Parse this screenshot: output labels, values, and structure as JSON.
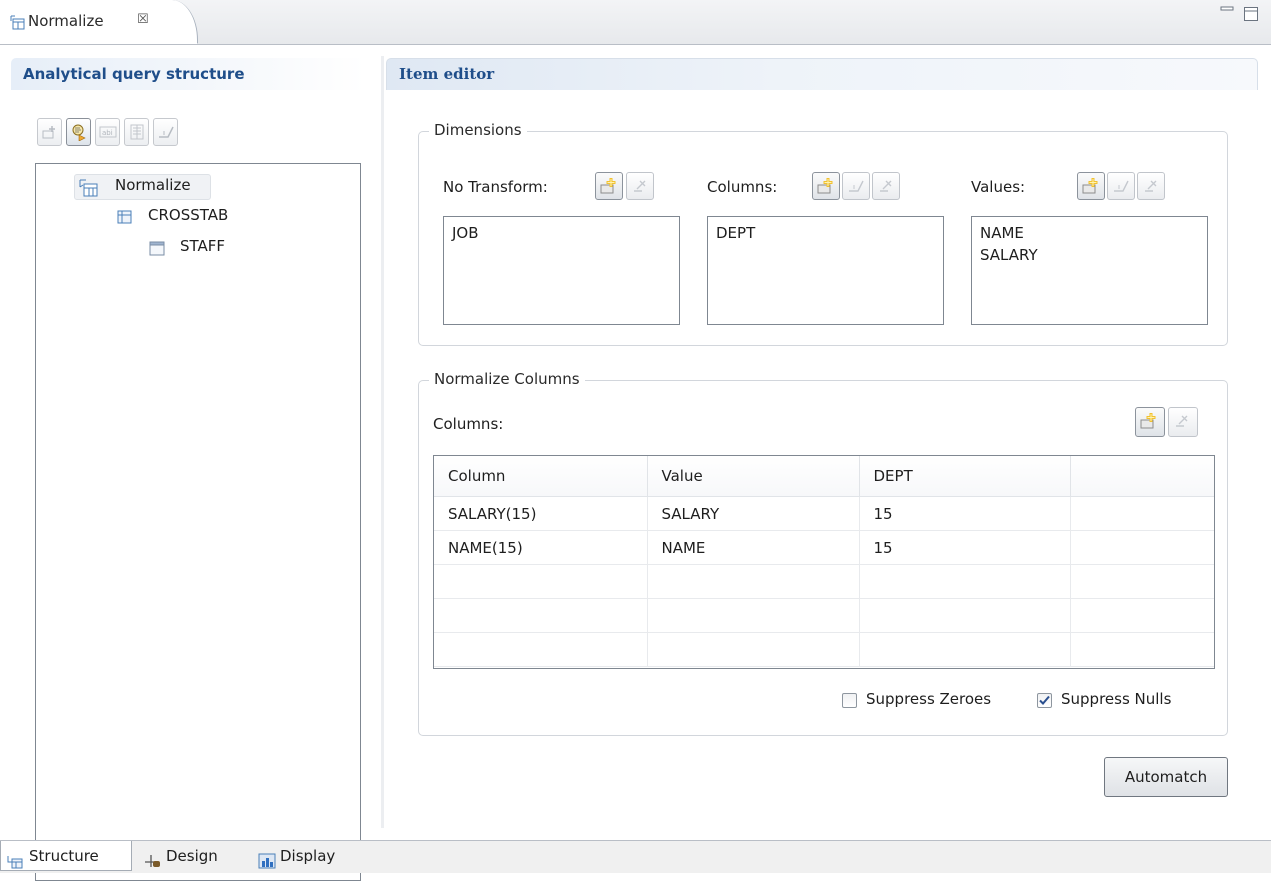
{
  "editor": {
    "tab_title": "Normalize",
    "tab_close_glyph": "☒",
    "tab_icon": "normalize-icon"
  },
  "left_panel": {
    "title": "Analytical query structure",
    "toolbar": [
      {
        "name": "add-node-button",
        "icon": "add-node-icon",
        "enabled": false
      },
      {
        "name": "edit-query-button",
        "icon": "query-search-icon",
        "enabled": true
      },
      {
        "name": "rename-button",
        "icon": "rename-icon",
        "enabled": false
      },
      {
        "name": "properties-button",
        "icon": "properties-icon",
        "enabled": false
      },
      {
        "name": "delete-node-button",
        "icon": "delete-node-icon",
        "enabled": false
      }
    ],
    "tree": {
      "root": {
        "label": "Normalize",
        "icon": "normalize-icon"
      },
      "child": {
        "label": "CROSSTAB",
        "icon": "crosstab-icon"
      },
      "grandchild": {
        "label": "STAFF",
        "icon": "table-icon"
      }
    }
  },
  "right_panel": {
    "title": "Item editor",
    "dimensions": {
      "title": "Dimensions",
      "no_transform": {
        "label": "No Transform:",
        "items": [
          "JOB"
        ]
      },
      "columns": {
        "label": "Columns:",
        "items": [
          "DEPT"
        ]
      },
      "values": {
        "label": "Values:",
        "items": [
          "NAME",
          "SALARY"
        ]
      }
    },
    "normalize_columns": {
      "title": "Normalize Columns",
      "columns_label": "Columns:",
      "table": {
        "headers": [
          "Column",
          "Value",
          "DEPT",
          ""
        ],
        "rows": [
          [
            "SALARY(15)",
            "SALARY",
            "15",
            ""
          ],
          [
            "NAME(15)",
            "NAME",
            "15",
            ""
          ],
          [
            "",
            "",
            "",
            ""
          ],
          [
            "",
            "",
            "",
            ""
          ],
          [
            "",
            "",
            "",
            ""
          ]
        ]
      },
      "suppress_zeroes": {
        "label": "Suppress Zeroes",
        "checked": false
      },
      "suppress_nulls": {
        "label": "Suppress Nulls",
        "checked": true
      }
    },
    "automatch_label": "Automatch"
  },
  "bottom_tabs": [
    {
      "label": "Structure",
      "icon": "structure-icon",
      "active": true
    },
    {
      "label": "Design",
      "icon": "design-icon",
      "active": false
    },
    {
      "label": "Display",
      "icon": "display-chart-icon",
      "active": false
    }
  ],
  "colors": {
    "header_text": "#1f4e8a",
    "add_icon_yellow": "#f2c12e",
    "border": "#7f8791"
  }
}
